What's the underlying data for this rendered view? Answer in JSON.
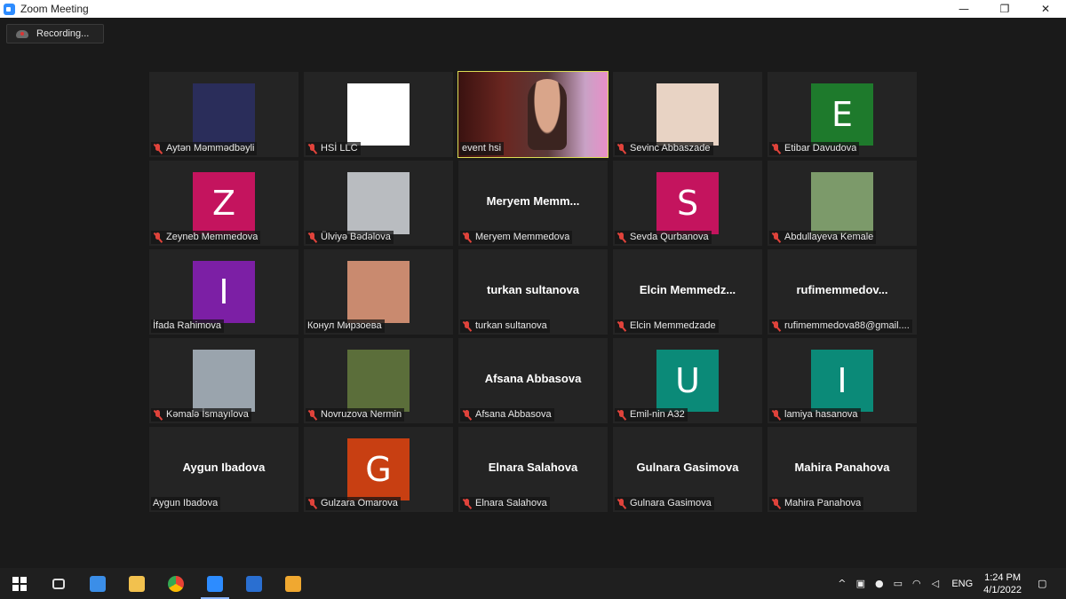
{
  "window": {
    "title": "Zoom Meeting",
    "minimize": "—",
    "maximize": "❐",
    "close": "✕"
  },
  "recording": {
    "label": "Recording..."
  },
  "participants": [
    {
      "name": "Aytən Məmmədbəyli",
      "kind": "image",
      "muted": true,
      "bg": "#2a2d5a"
    },
    {
      "name": "HSİ LLC",
      "kind": "image",
      "muted": true,
      "bg": "#ffffff"
    },
    {
      "name": "event hsi",
      "kind": "video",
      "muted": false,
      "speaking": true
    },
    {
      "name": "Sevinc Abbaszade",
      "kind": "image",
      "muted": true,
      "bg": "#e8d3c4"
    },
    {
      "name": "Etibar Davudova",
      "kind": "letter",
      "letter": "E",
      "muted": true,
      "bg": "#1e7a2c"
    },
    {
      "name": "Zeyneb Memmedova",
      "kind": "letter",
      "letter": "Z",
      "muted": true,
      "bg": "#c4145e"
    },
    {
      "name": "Ülviyə Bədəlova",
      "kind": "image",
      "muted": true,
      "bg": "#b9bcc0"
    },
    {
      "name": "Meryem Memmedova",
      "kind": "text",
      "display": "Meryem  Memm...",
      "muted": true
    },
    {
      "name": "Sevda Qurbanova",
      "kind": "letter",
      "letter": "S",
      "muted": true,
      "bg": "#c4145e"
    },
    {
      "name": "Abdullayeva Kemale",
      "kind": "image",
      "muted": true,
      "bg": "#7c9a6a"
    },
    {
      "name": "İfada Rahimova",
      "kind": "letter",
      "letter": "I",
      "muted": false,
      "bg": "#7c1fa5"
    },
    {
      "name": "Конул Мирзоева",
      "kind": "image",
      "muted": false,
      "bg": "#c98a6f"
    },
    {
      "name": "turkan sultanova",
      "kind": "text",
      "display": "turkan sultanova",
      "muted": true
    },
    {
      "name": "Elcin Memmedzade",
      "kind": "text",
      "display": "Elcin  Memmedz...",
      "muted": true
    },
    {
      "name": "rufimemmedova88@gmail....",
      "kind": "text",
      "display": "rufimemmedov...",
      "muted": true
    },
    {
      "name": "Kəmalə İsmayılova",
      "kind": "image",
      "muted": true,
      "bg": "#9aa4ad"
    },
    {
      "name": "Novruzova Nermin",
      "kind": "image",
      "muted": true,
      "bg": "#5b6e3a"
    },
    {
      "name": "Afsana Abbasova",
      "kind": "text",
      "display": "Afsana Abbasova",
      "muted": true
    },
    {
      "name": "Emil-nin A32",
      "kind": "letter",
      "letter": "U",
      "muted": true,
      "bg": "#0b8a78"
    },
    {
      "name": "lamiya hasanova",
      "kind": "letter",
      "letter": "I",
      "muted": true,
      "bg": "#0b8a78"
    },
    {
      "name": "Aygun Ibadova",
      "kind": "text",
      "display": "Aygun Ibadova",
      "muted": false
    },
    {
      "name": "Gulzara Omarova",
      "kind": "letter",
      "letter": "G",
      "muted": true,
      "bg": "#c83f12"
    },
    {
      "name": "Elnara Salahova",
      "kind": "text",
      "display": "Elnara Salahova",
      "muted": true
    },
    {
      "name": "Gulnara Gasimova",
      "kind": "text",
      "display": "Gulnara Gasimova",
      "muted": true
    },
    {
      "name": "Mahira Panahova",
      "kind": "text",
      "display": "Mahira Panahova",
      "muted": true
    }
  ],
  "taskbar": {
    "apps": [
      {
        "icon": "windows-start-icon",
        "color": "#ffffff"
      },
      {
        "icon": "task-view-icon",
        "color": "#dddddd"
      },
      {
        "icon": "microsoft-store-icon",
        "color": "#3b8ee8"
      },
      {
        "icon": "file-explorer-icon",
        "color": "#f2c14e"
      },
      {
        "icon": "chrome-icon",
        "color": "#e94235"
      },
      {
        "icon": "zoom-icon",
        "color": "#2d8cff",
        "active": true
      },
      {
        "icon": "photos-icon",
        "color": "#2a6fd1"
      },
      {
        "icon": "media-player-icon",
        "color": "#f0a830"
      }
    ],
    "tray": {
      "language": "ENG",
      "time": "1:24 PM",
      "date": "4/1/2022"
    }
  }
}
